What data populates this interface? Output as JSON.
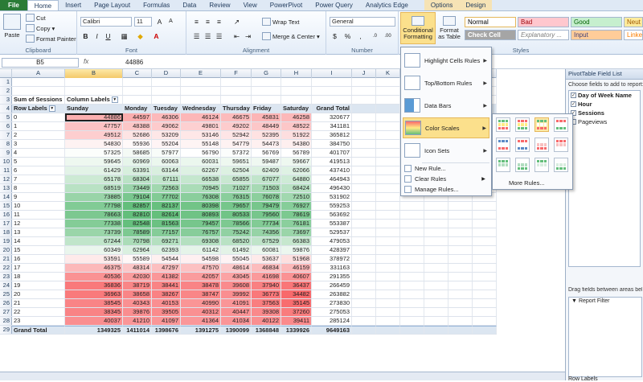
{
  "ribbon_tabs": [
    "File",
    "Home",
    "Insert",
    "Page Layout",
    "Formulas",
    "Data",
    "Review",
    "View",
    "PowerPivot",
    "Power Query",
    "Analytics Edge",
    "Options",
    "Design"
  ],
  "groups": {
    "clipboard": "Clipboard",
    "font": "Font",
    "alignment": "Alignment",
    "number": "Number",
    "styles": "Styles"
  },
  "clipboard": {
    "paste": "Paste",
    "cut": "Cut",
    "copy": "Copy",
    "format_painter": "Format Painter"
  },
  "font": {
    "name": "Calibri",
    "size": "11"
  },
  "alignment": {
    "wrap_text": "Wrap Text",
    "merge_center": "Merge & Center"
  },
  "number": {
    "format": "General"
  },
  "styles": {
    "conditional_formatting": "Conditional Formatting",
    "format_as_table": "Format as Table",
    "cells": [
      {
        "label": "Normal",
        "bg": "#ffffff",
        "fg": "#000000"
      },
      {
        "label": "Bad",
        "bg": "#ffc7ce",
        "fg": "#9c0006"
      },
      {
        "label": "Good",
        "bg": "#c6efce",
        "fg": "#006100"
      },
      {
        "label": "Neut",
        "bg": "#ffeb9c",
        "fg": "#9c5700"
      },
      {
        "label": "Check Cell",
        "bg": "#a5a5a5",
        "fg": "#ffffff"
      },
      {
        "label": "Explanatory ...",
        "bg": "#ffffff",
        "fg": "#7f7f7f"
      },
      {
        "label": "Input",
        "bg": "#ffcc99",
        "fg": "#3f3f76"
      },
      {
        "label": "Linke",
        "bg": "#ffffff",
        "fg": "#fa7d00"
      }
    ]
  },
  "formula_bar": {
    "name_box": "B5",
    "fx": "fx",
    "value": "44886"
  },
  "columns": [
    "A",
    "B",
    "C",
    "D",
    "E",
    "F",
    "G",
    "H",
    "I",
    "J",
    "K",
    "L",
    "M",
    "N",
    "O"
  ],
  "pivot": {
    "title_label": "Sum of Sessions",
    "column_labels": "Column Labels",
    "row_labels": "Row Labels",
    "headers": [
      "Sunday",
      "Monday",
      "Tuesday",
      "Wednesday",
      "Thursday",
      "Friday",
      "Saturday",
      "Grand Total"
    ],
    "rows": [
      {
        "label": "0",
        "values": [
          44886,
          44597,
          46306,
          46124,
          46675,
          45831,
          46258,
          320677
        ]
      },
      {
        "label": "1",
        "values": [
          47757,
          48388,
          49062,
          49801,
          49202,
          48449,
          48522,
          341181
        ]
      },
      {
        "label": "2",
        "values": [
          49512,
          52686,
          53209,
          53146,
          52942,
          52395,
          51922,
          365812
        ]
      },
      {
        "label": "3",
        "values": [
          54830,
          55936,
          55204,
          55148,
          54779,
          54473,
          54380,
          384750
        ]
      },
      {
        "label": "4",
        "values": [
          57325,
          58685,
          57977,
          56790,
          57372,
          56769,
          56789,
          401707
        ]
      },
      {
        "label": "5",
        "values": [
          59645,
          60969,
          60063,
          60031,
          59651,
          59487,
          59667,
          419513
        ]
      },
      {
        "label": "6",
        "values": [
          61429,
          63391,
          63144,
          62267,
          62504,
          62409,
          62066,
          437410
        ]
      },
      {
        "label": "7",
        "values": [
          65178,
          68304,
          67111,
          66538,
          65855,
          67077,
          64880,
          464943
        ]
      },
      {
        "label": "8",
        "values": [
          68519,
          73449,
          72563,
          70945,
          71027,
          71503,
          68424,
          496430
        ]
      },
      {
        "label": "9",
        "values": [
          73885,
          79104,
          77702,
          76308,
          76315,
          76078,
          72510,
          531902
        ]
      },
      {
        "label": "10",
        "values": [
          77798,
          82857,
          82137,
          80398,
          79657,
          79479,
          76927,
          559253
        ]
      },
      {
        "label": "11",
        "values": [
          78663,
          82810,
          82614,
          80893,
          80533,
          79560,
          78619,
          563692
        ]
      },
      {
        "label": "12",
        "values": [
          77338,
          82548,
          81563,
          79457,
          78566,
          77734,
          76181,
          553387
        ]
      },
      {
        "label": "13",
        "values": [
          73739,
          78589,
          77157,
          76757,
          75242,
          74356,
          73697,
          529537
        ]
      },
      {
        "label": "14",
        "values": [
          67244,
          70798,
          69271,
          69308,
          68520,
          67529,
          66383,
          479053
        ]
      },
      {
        "label": "15",
        "values": [
          60349,
          62964,
          62393,
          61142,
          61492,
          60081,
          59876,
          428397
        ]
      },
      {
        "label": "16",
        "values": [
          53591,
          55589,
          54544,
          54598,
          55045,
          53637,
          51968,
          378972
        ]
      },
      {
        "label": "17",
        "values": [
          46375,
          48314,
          47297,
          47570,
          48614,
          46834,
          46159,
          331163
        ]
      },
      {
        "label": "18",
        "values": [
          40536,
          42030,
          41382,
          42057,
          43045,
          41698,
          40607,
          291355
        ]
      },
      {
        "label": "19",
        "values": [
          36836,
          38719,
          38441,
          38478,
          39608,
          37940,
          36437,
          266459
        ]
      },
      {
        "label": "20",
        "values": [
          36963,
          38658,
          38267,
          38747,
          39992,
          36773,
          34482,
          263882
        ]
      },
      {
        "label": "21",
        "values": [
          38545,
          40343,
          40153,
          40990,
          41091,
          37563,
          35145,
          273830
        ]
      },
      {
        "label": "22",
        "values": [
          38345,
          39876,
          39505,
          40312,
          40447,
          39308,
          37260,
          275053
        ]
      },
      {
        "label": "23",
        "values": [
          40037,
          41210,
          41097,
          41364,
          41034,
          40122,
          39411,
          285124
        ]
      }
    ],
    "grand_total_label": "Grand Total",
    "grand_totals": [
      1349325,
      1411014,
      1398676,
      1391275,
      1390099,
      1368848,
      1339926,
      9649163
    ]
  },
  "scale_colors": {
    "low": "#f8696b",
    "mid": "#ffffff",
    "high": "#63be7b"
  },
  "cf_menu": {
    "items": [
      "Highlight Cells Rules",
      "Top/Bottom Rules",
      "Data Bars",
      "Color Scales",
      "Icon Sets"
    ],
    "small_items": [
      "New Rule...",
      "Clear Rules",
      "Manage Rules..."
    ],
    "more_rules": "More Rules..."
  },
  "field_list": {
    "title": "PivotTable Field List",
    "subtitle": "Choose fields to add to report:",
    "fields": [
      {
        "name": "Day of Week Name",
        "checked": true
      },
      {
        "name": "Hour",
        "checked": true
      },
      {
        "name": "Sessions",
        "checked": true
      },
      {
        "name": "Pageviews",
        "checked": false
      }
    ],
    "drag_hint": "Drag fields between areas below:",
    "report_filter": "Report Filter",
    "row_labels": "Row Labels"
  }
}
